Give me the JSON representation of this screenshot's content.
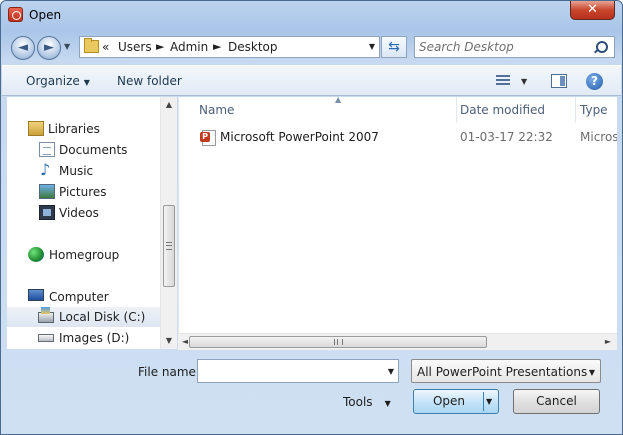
{
  "window": {
    "title": "Open",
    "close_glyph": "✕"
  },
  "address": {
    "breadcrumb_prefix": "«",
    "crumbs": [
      "Users",
      "Admin",
      "Desktop"
    ],
    "search_placeholder": "Search Desktop"
  },
  "toolbar": {
    "organize": "Organize",
    "new_folder": "New folder"
  },
  "nav": {
    "items": [
      {
        "label": "Libraries",
        "icon": "libraries-icon"
      },
      {
        "label": "Documents",
        "icon": "documents-icon"
      },
      {
        "label": "Music",
        "icon": "music-icon"
      },
      {
        "label": "Pictures",
        "icon": "pictures-icon"
      },
      {
        "label": "Videos",
        "icon": "videos-icon"
      },
      {
        "label": "Homegroup",
        "icon": "homegroup-icon"
      },
      {
        "label": "Computer",
        "icon": "computer-icon"
      },
      {
        "label": "Local Disk (C:)",
        "icon": "hard-disk-icon",
        "selected": true
      },
      {
        "label": "Images (D:)",
        "icon": "optical-drive-icon"
      }
    ]
  },
  "columns": {
    "name": "Name",
    "date": "Date modified",
    "type": "Type"
  },
  "files": [
    {
      "name": "Microsoft PowerPoint 2007",
      "date": "01-03-17 22:32",
      "type": "Microso"
    }
  ],
  "footer": {
    "filename_label": "File name:",
    "filename_value": "",
    "filetype_value": "All PowerPoint Presentations",
    "tools": "Tools",
    "open": "Open",
    "cancel": "Cancel"
  }
}
